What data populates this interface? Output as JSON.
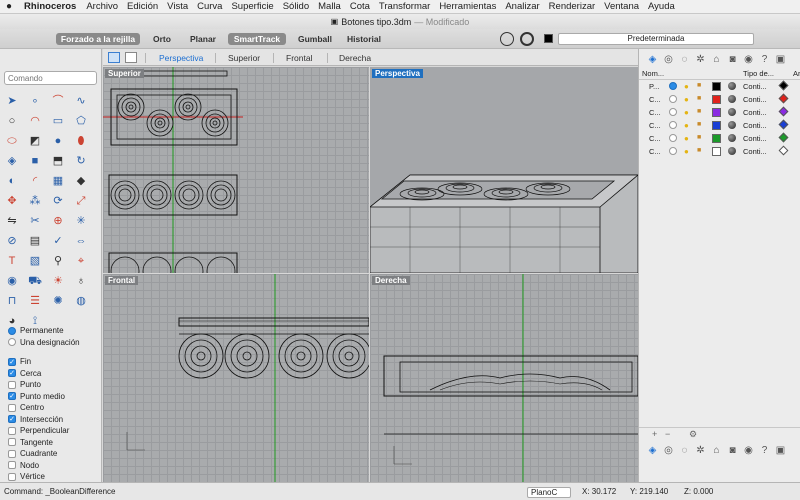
{
  "menubar": {
    "apple": "",
    "app": "Rhinoceros",
    "items": [
      "Archivo",
      "Edición",
      "Vista",
      "Curva",
      "Superficie",
      "Sólido",
      "Malla",
      "Cota",
      "Transformar",
      "Herramientas",
      "Analizar",
      "Renderizar",
      "Ventana",
      "Ayuda"
    ]
  },
  "window": {
    "title": "Botones tipo.3dm",
    "status": "— Modificado"
  },
  "toolbar": {
    "buttons": [
      "Forzado a la rejilla",
      "Orto",
      "Planar",
      "SmartTrack",
      "Gumball",
      "Historial"
    ],
    "layer_current": "Predeterminada"
  },
  "left": {
    "command_placeholder": "Comando",
    "osnap_modes": [
      "Permanente",
      "Una designación"
    ],
    "osnaps": [
      {
        "label": "Fin",
        "on": true
      },
      {
        "label": "Cerca",
        "on": true
      },
      {
        "label": "Punto",
        "on": false
      },
      {
        "label": "Punto medio",
        "on": true
      },
      {
        "label": "Centro",
        "on": false
      },
      {
        "label": "Intersección",
        "on": true
      },
      {
        "label": "Perpendicular",
        "on": false
      },
      {
        "label": "Tangente",
        "on": false
      },
      {
        "label": "Cuadrante",
        "on": false
      },
      {
        "label": "Nodo",
        "on": false
      },
      {
        "label": "Vértice",
        "on": false
      }
    ]
  },
  "viewports": {
    "tabs": [
      "Perspectiva",
      "Superior",
      "Frontal",
      "Derecha"
    ],
    "labels": {
      "top": "Superior",
      "persp": "Perspectiva",
      "front": "Frontal",
      "right": "Derecha"
    }
  },
  "layers": {
    "headers": {
      "name": "Nom...",
      "linetype": "Tipo de...",
      "extra": "Ar"
    },
    "rows": [
      {
        "name": "P...",
        "current": true,
        "color": "#000000",
        "linetype": "Conti..."
      },
      {
        "name": "C...",
        "current": false,
        "color": "#e0221b",
        "linetype": "Conti..."
      },
      {
        "name": "C...",
        "current": false,
        "color": "#8a2be2",
        "linetype": "Conti..."
      },
      {
        "name": "C...",
        "current": false,
        "color": "#1a3fd4",
        "linetype": "Conti..."
      },
      {
        "name": "C...",
        "current": false,
        "color": "#1b9a2a",
        "linetype": "Conti..."
      },
      {
        "name": "C...",
        "current": false,
        "color": "#ffffff",
        "linetype": "Conti..."
      }
    ],
    "footer_add": "+",
    "footer_remove": "−"
  },
  "status": {
    "command": "Command: _BooleanDifference",
    "cplane": "PlanoC",
    "x": "X: 30.172",
    "y": "Y: 219.140",
    "z": "Z: 0.000"
  }
}
